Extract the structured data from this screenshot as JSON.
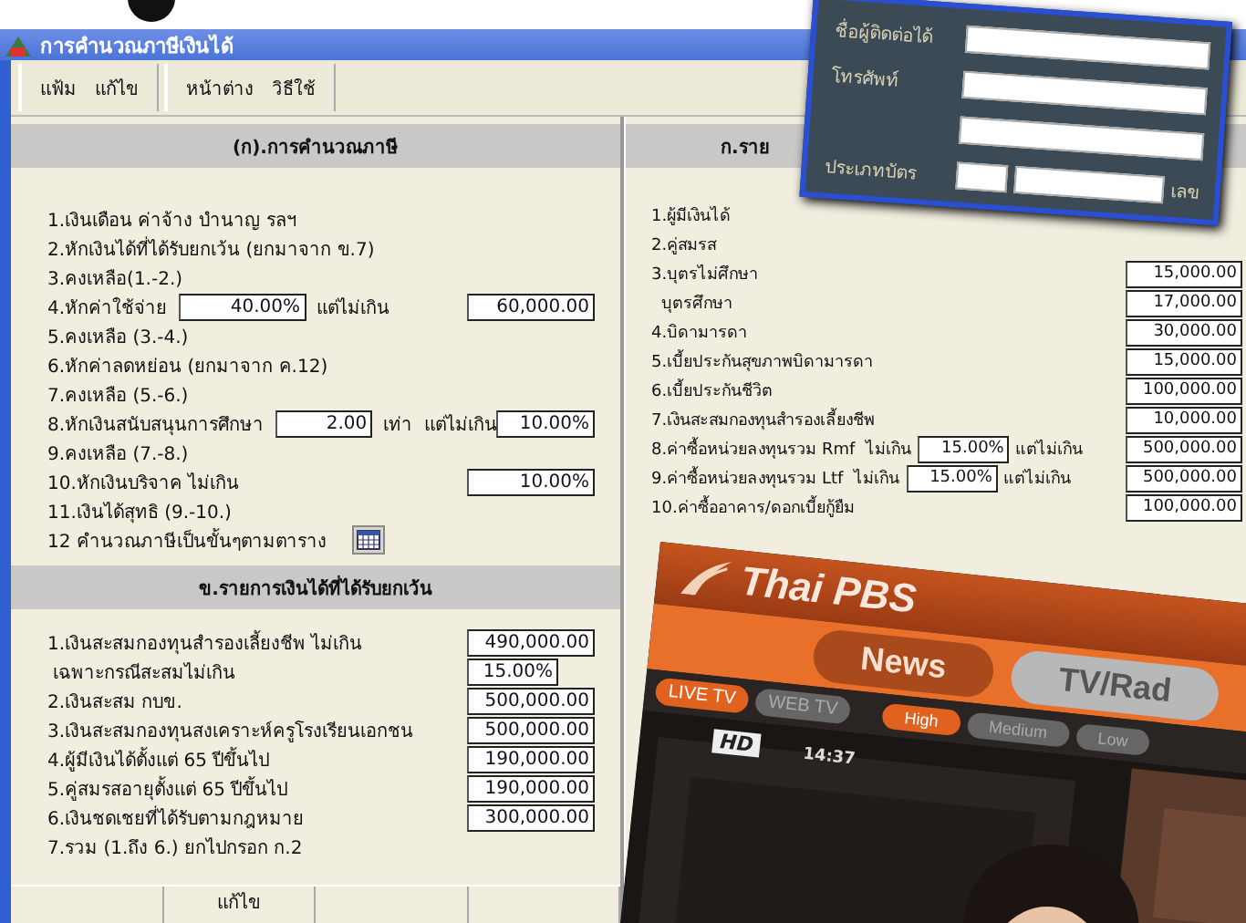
{
  "window": {
    "title": "การคำนวณภาษีเงินได้"
  },
  "menu_groups": [
    {
      "items": [
        {
          "label": "แฟ้ม"
        },
        {
          "label": "แก้ไข"
        }
      ]
    },
    {
      "items": [
        {
          "label": "หน้าต่าง"
        },
        {
          "label": "วิธีใช้"
        }
      ]
    }
  ],
  "section_a": {
    "title": "(ก).การคำนวณภาษี",
    "rows": [
      {
        "kind": "text",
        "label": "1.เงินเดือน ค่าจ้าง บำนาญ รลฯ"
      },
      {
        "kind": "text",
        "label": "2.หักเงินได้ที่ได้รับยกเว้น (ยกมาจาก ข.7)"
      },
      {
        "kind": "text",
        "label": "3.คงเหลือ(1.-2.)"
      },
      {
        "kind": "input",
        "label": "4.หักค่าใช้จ่าย",
        "input": "40.00%",
        "note": "แต่ไม่เกิน",
        "limit": "60,000.00"
      },
      {
        "kind": "text",
        "label": "5.คงเหลือ (3.-4.)"
      },
      {
        "kind": "text",
        "label": "6.หักค่าลดหย่อน (ยกมาจาก ค.12)"
      },
      {
        "kind": "text",
        "label": "7.คงเหลือ (5.-6.)"
      },
      {
        "kind": "input",
        "label": "8.หักเงินสนับสนุนการศึกษา",
        "input": "2.00",
        "note": "เท่า  แต่ไม่เกิน",
        "limit": "10.00%"
      },
      {
        "kind": "text",
        "label": "9.คงเหลือ (7.-8.)"
      },
      {
        "kind": "input",
        "label": "10.หักเงินบริจาค ไม่เกิน",
        "limit": "10.00%"
      },
      {
        "kind": "text",
        "label": "11.เงินได้สุทธิ (9.-10.)"
      },
      {
        "kind": "button",
        "label": "12 คำนวณภาษีเป็นขั้นๆตามตาราง"
      }
    ]
  },
  "section_b": {
    "title": "ข.รายการเงินได้ที่ได้รับยกเว้น",
    "rows": [
      {
        "label": "1.เงินสะสมกองทุนสำรองเลี้ยงชีพ ไม่เกิน",
        "value": "490,000.00"
      },
      {
        "label": " เฉพาะกรณีสะสมไม่เกิน",
        "input": "15.00%"
      },
      {
        "label": "2.เงินสะสม กบข.",
        "value": "500,000.00"
      },
      {
        "label": "3.เงินสะสมกองทุนสงเคราะห์ครูโรงเรียนเอกชน",
        "value": "500,000.00"
      },
      {
        "label": "4.ผู้มีเงินได้ตั้งแต่ 65 ปีขึ้นไป",
        "value": "190,000.00"
      },
      {
        "label": "5.คู่สมรสอายุตั้งแต่ 65 ปีขึ้นไป",
        "value": "190,000.00"
      },
      {
        "label": "6.เงินชดเชยที่ได้รับตามกฎหมาย",
        "value": "300,000.00"
      },
      {
        "label": "7.รวม (1.ถึง 6.) ยกไปกรอก ก.2"
      }
    ]
  },
  "status_bar": [
    {
      "kind": "empty"
    },
    {
      "kind": "text",
      "text": "แก้ไข"
    },
    {
      "kind": "empty"
    },
    {
      "kind": "empty"
    }
  ],
  "section_c": {
    "title": "ก.ราย",
    "rows": [
      {
        "label": "1.ผู้มีเงินได้"
      },
      {
        "label": "2.คู่สมรส"
      },
      {
        "label": "3.บุตรไม่ศึกษา",
        "value": "15,000.00"
      },
      {
        "label": "  บุตรศึกษา",
        "value": "17,000.00"
      },
      {
        "label": "4.บิดามารดา",
        "value": "30,000.00"
      },
      {
        "label": "5.เบี้ยประกันสุขภาพบิดามารดา",
        "value": "15,000.00"
      },
      {
        "label": "6.เบี้ยประกันชีวิต",
        "value": "100,000.00"
      },
      {
        "label": "7.เงินสะสมกองทุนสำรองเลี้ยงชีพ",
        "value": "10,000.00"
      },
      {
        "label": "8.ค่าซื้อหน่วยลงทุนรวม Rmf  ไม่เกิน",
        "input": "15.00%",
        "note": "แต่ไม่เกิน",
        "value": "500,000.00"
      },
      {
        "label": "9.ค่าซื้อหน่วยลงทุนรวม Ltf  ไม่เกิน",
        "input": "15.00%",
        "note": "แต่ไม่เกิน",
        "value": "500,000.00"
      },
      {
        "label": "10.ค่าซื้ออาคาร/ดอกเบี้ยกู้ยืม",
        "value": "100,000.00"
      }
    ]
  },
  "overlay_form": {
    "fields": [
      {
        "label": "ชื่อผู้ติดต่อได้"
      },
      {
        "label": "โทรศัพท์"
      }
    ],
    "card_label": "ประเภทบัตร",
    "number_label": "เลข"
  },
  "overlay_app": {
    "logo": "Thai PBS",
    "tabs": [
      {
        "label": "News",
        "selected": true
      },
      {
        "label": "TV/Rad",
        "selected": false
      }
    ],
    "sources": [
      {
        "label": "LIVE TV",
        "selected": true
      },
      {
        "label": "WEB TV",
        "selected": false
      }
    ],
    "quality": [
      {
        "label": "High",
        "selected": true
      },
      {
        "label": "Medium",
        "selected": false
      },
      {
        "label": "Low",
        "selected": false
      }
    ],
    "video": {
      "badge": "HD",
      "time": "14:37",
      "kind": "picture"
    }
  }
}
